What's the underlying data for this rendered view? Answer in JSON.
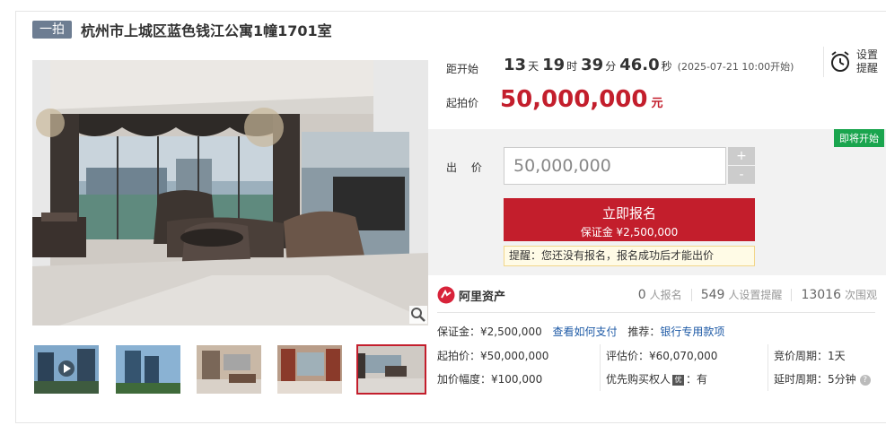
{
  "header": {
    "badge": "一拍",
    "title": "杭州市上城区蓝色钱江公寓1幢1701室"
  },
  "countdown": {
    "label": "距开始",
    "days": "13",
    "days_unit": "天",
    "hours": "19",
    "hours_unit": "时",
    "minutes": "39",
    "minutes_unit": "分",
    "seconds": "46.0",
    "seconds_unit": "秒",
    "start_time": "(2025-07-21 10:00开始)"
  },
  "reminder": {
    "label": "设置提醒"
  },
  "start_price": {
    "label": "起拍价",
    "value": "50,000,000",
    "unit": "元"
  },
  "bid": {
    "status_tag": "即将开始",
    "label": "出 价",
    "input_value": "50,000,000",
    "plus": "+",
    "minus": "-",
    "apply_label": "立即报名",
    "apply_deposit": "保证金 ¥2,500,000",
    "tip": "提醒：您还没有报名，报名成功后才能出价"
  },
  "stats": {
    "brand": "阿里资产",
    "applicants": "0",
    "applicants_label": "人报名",
    "reminders": "549",
    "reminders_label": "人设置提醒",
    "views": "13016",
    "views_label": "次围观"
  },
  "deposit": {
    "text": "保证金：¥2,500,000",
    "how_to_pay": "查看如何支付",
    "recommend_label": "推荐：",
    "recommend_link": "银行专用款项"
  },
  "details": {
    "start_price": "起拍价：¥50,000,000",
    "increment": "加价幅度：¥100,000",
    "appraisal": "评估价：¥60,070,000",
    "priority_prefix": "优先购买权人",
    "priority_icon": "优",
    "priority_suffix": "：有",
    "bid_cycle": "竞价周期：1天",
    "delay_cycle": "延时周期：5分钟",
    "help": "?"
  },
  "icons": {
    "zoom": "magnifier-icon",
    "alarm": "alarm-clock-icon",
    "play": "play-icon",
    "brand_logo": "ali-asset-logo-icon"
  },
  "colors": {
    "accent": "#c31e2c",
    "badge": "#6d7d92",
    "success": "#1aa54e",
    "link": "#1e5aa6"
  }
}
